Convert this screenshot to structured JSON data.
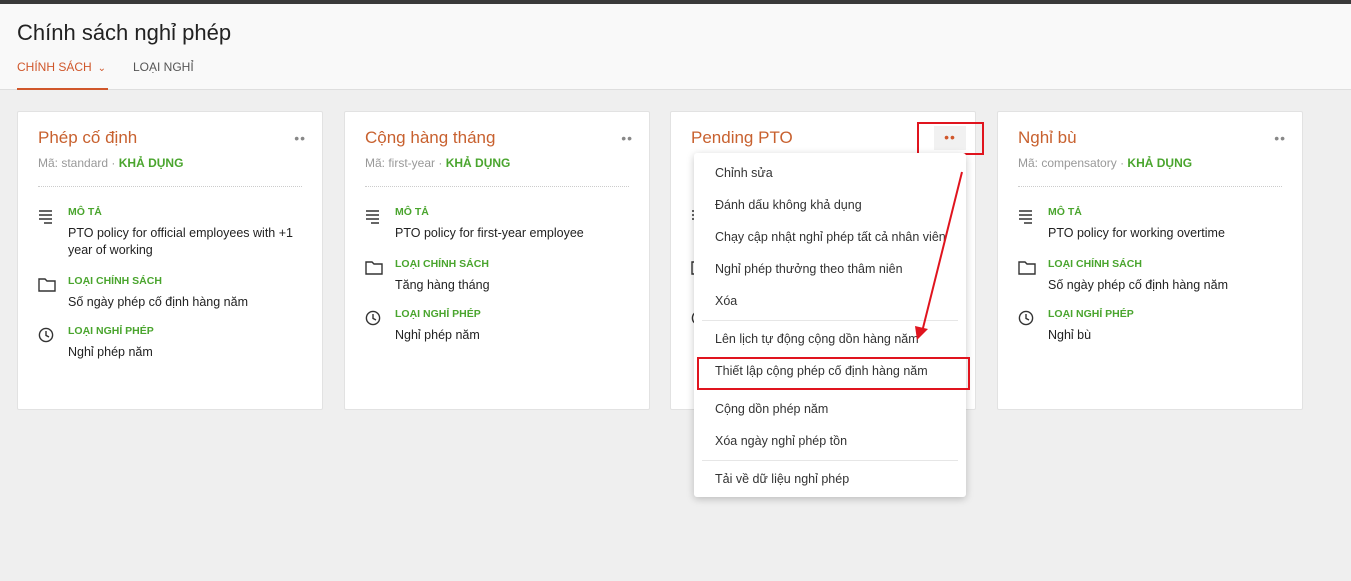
{
  "page": {
    "title": "Chính sách nghỉ phép",
    "tabs": [
      {
        "label": "CHÍNH SÁCH",
        "active": true
      },
      {
        "label": "LOẠI NGHỈ",
        "active": false
      }
    ]
  },
  "cards": [
    {
      "title": "Phép cố định",
      "code_label": "Mã: standard",
      "separator": "·",
      "status": "KHẢ DỤNG",
      "description_label": "MÔ TẢ",
      "description": "PTO policy for official employees with +1 year of working",
      "policy_type_label": "LOẠI CHÍNH SÁCH",
      "policy_type": "Số ngày phép cố định hàng năm",
      "leave_type_label": "LOẠI NGHỈ PHÉP",
      "leave_type": "Nghỉ phép năm"
    },
    {
      "title": "Cộng hàng tháng",
      "code_label": "Mã: first-year",
      "separator": "·",
      "status": "KHẢ DỤNG",
      "description_label": "MÔ TẢ",
      "description": "PTO policy for first-year employee",
      "policy_type_label": "LOẠI CHÍNH SÁCH",
      "policy_type": "Tăng hàng tháng",
      "leave_type_label": "LOẠI NGHỈ PHÉP",
      "leave_type": "Nghỉ phép năm"
    },
    {
      "title": "Pending PTO"
    },
    {
      "title": "Nghỉ bù",
      "code_label": "Mã: compensatory",
      "separator": "·",
      "status": "KHẢ DỤNG",
      "description_label": "MÔ TẢ",
      "description": "PTO policy for working overtime",
      "policy_type_label": "LOẠI CHÍNH SÁCH",
      "policy_type": "Số ngày phép cố định hàng năm",
      "leave_type_label": "LOẠI NGHỈ PHÉP",
      "leave_type": "Nghỉ bù"
    }
  ],
  "more_glyph": "••",
  "menu": {
    "items": [
      "Chỉnh sửa",
      "Đánh dấu không khả dụng",
      "Chạy cập nhật nghỉ phép tất cả nhân viên",
      "Nghỉ phép thưởng theo thâm niên",
      "Xóa",
      "Lên lịch tự động cộng dồn hàng năm",
      "Thiết lập cộng phép cố định hàng năm",
      "Cộng dồn phép năm",
      "Xóa ngày nghỉ phép tồn",
      "Tải về dữ liệu nghỉ phép"
    ],
    "highlighted_item": "Thiết lập cộng phép cố định hàng năm"
  },
  "colors": {
    "accent": "#d0572b",
    "card_title": "#c8612f",
    "available": "#4aa52e",
    "annotation": "#e0141e"
  },
  "icons": {
    "description": "lines-icon",
    "policy_type": "folder-icon",
    "leave_type": "clock-icon",
    "more": "more-dots-icon"
  }
}
